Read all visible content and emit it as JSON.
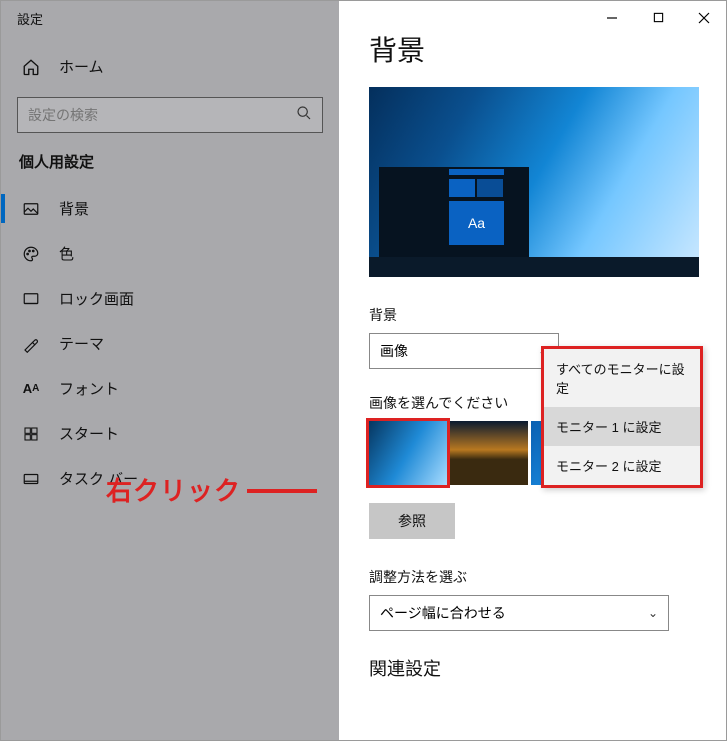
{
  "window": {
    "title": "設定"
  },
  "sidebar": {
    "home": "ホーム",
    "search_placeholder": "設定の検索",
    "section": "個人用設定",
    "items": [
      {
        "label": "背景",
        "icon": "picture-icon"
      },
      {
        "label": "色",
        "icon": "palette-icon"
      },
      {
        "label": "ロック画面",
        "icon": "lock-screen-icon"
      },
      {
        "label": "テーマ",
        "icon": "theme-icon"
      },
      {
        "label": "フォント",
        "icon": "font-icon"
      },
      {
        "label": "スタート",
        "icon": "start-icon"
      },
      {
        "label": "タスク バー",
        "icon": "taskbar-icon"
      }
    ]
  },
  "main": {
    "title": "背景",
    "preview_tile_text": "Aa",
    "bg_label": "背景",
    "bg_value": "画像",
    "choose_label": "画像を選んでください",
    "browse": "参照",
    "fit_label": "調整方法を選ぶ",
    "fit_value": "ページ幅に合わせる",
    "related": "関連設定"
  },
  "context_menu": {
    "items": [
      "すべてのモニターに設定",
      "モニター 1 に設定",
      "モニター 2 に設定"
    ]
  },
  "annotation": {
    "text": "右クリック"
  }
}
